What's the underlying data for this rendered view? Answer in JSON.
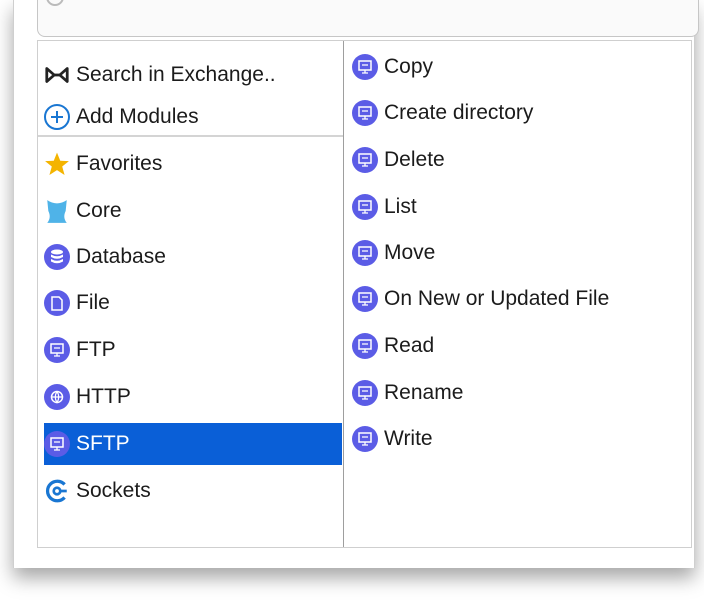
{
  "left_items": [
    {
      "label": "Search in Exchange..",
      "icon": "exchange-icon"
    },
    {
      "label": "Add Modules",
      "icon": "plus-circle-icon"
    },
    {
      "label": "Favorites",
      "icon": "star-icon"
    },
    {
      "label": "Core",
      "icon": "core-icon"
    },
    {
      "label": "Database",
      "icon": "database-icon"
    },
    {
      "label": "File",
      "icon": "file-icon"
    },
    {
      "label": "FTP",
      "icon": "ftp-icon"
    },
    {
      "label": "HTTP",
      "icon": "globe-icon"
    },
    {
      "label": "SFTP",
      "icon": "sftp-icon",
      "selected": true
    },
    {
      "label": "Sockets",
      "icon": "sockets-icon"
    }
  ],
  "right_items": [
    {
      "label": "Copy",
      "icon": "sftp-operation-icon"
    },
    {
      "label": "Create directory",
      "icon": "sftp-operation-icon"
    },
    {
      "label": "Delete",
      "icon": "sftp-operation-icon"
    },
    {
      "label": "List",
      "icon": "sftp-operation-icon"
    },
    {
      "label": "Move",
      "icon": "sftp-operation-icon"
    },
    {
      "label": "On New or Updated File",
      "icon": "sftp-operation-icon"
    },
    {
      "label": "Read",
      "icon": "sftp-operation-icon"
    },
    {
      "label": "Rename",
      "icon": "sftp-operation-icon"
    },
    {
      "label": "Write",
      "icon": "sftp-operation-icon"
    }
  ],
  "colors": {
    "accent": "#0a5fd7",
    "icon_purple": "#5b5ce6",
    "star": "#f4b400",
    "core": "#4fb3e8",
    "sockets": "#1976d2"
  }
}
